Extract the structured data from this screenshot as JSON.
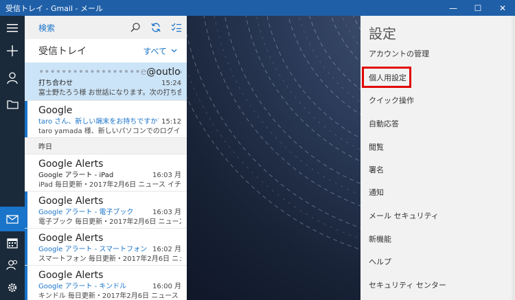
{
  "window": {
    "title": "受信トレイ - Gmail - メール",
    "minimize": "—",
    "maximize": "☐",
    "close": "✕"
  },
  "toolbar": {
    "search_label": "検索"
  },
  "inbox": {
    "title": "受信トレイ",
    "filter": "すべて"
  },
  "messages": [
    {
      "from": "@outlook.jp",
      "from_blurred": "••••••••••••••••••e",
      "subject": "打ち合わせ",
      "time": "15:24",
      "preview": "富士野たろう様 お世話になります。次の打ち合わ"
    },
    {
      "from": "Google",
      "subject": "taro さん、新しい端末をお持ちですか？Window",
      "time": "15:12",
      "preview": "taro yamada 様、新しいパソコンでのログインに成功"
    }
  ],
  "group_yesterday": "昨日",
  "alerts": [
    {
      "from": "Google Alerts",
      "subject": "Google アラート - iPad",
      "time": "16:03 月",
      "preview": "iPad 毎日更新・2017年2月6日 ニュース イチオ"
    },
    {
      "from": "Google Alerts",
      "subject": "Google アラート - 電子ブック",
      "time": "16:03 月",
      "preview": "電子ブック 毎日更新・2017年2月6日 ニュース"
    },
    {
      "from": "Google Alerts",
      "subject": "Google アラート - スマートフォン",
      "time": "16:02 月",
      "preview": "スマートフォン 毎日更新・2017年2月6日 ニュース"
    },
    {
      "from": "Google Alerts",
      "subject": "Google アラート - キンドル",
      "time": "16:00 月",
      "preview": "キンドル 毎日更新・2017年2月6日 ニュース"
    }
  ],
  "settings": {
    "title": "設定",
    "items": [
      "アカウントの管理",
      "個人用設定",
      "クイック操作",
      "自動応答",
      "閲覧",
      "署名",
      "通知",
      "メール セキュリティ",
      "新機能",
      "ヘルプ",
      "セキュリティ センター"
    ]
  },
  "colors": {
    "titlebar": "#1f5fa8",
    "accent": "#1a74c9",
    "rail": "#1b2a3a",
    "highlight": "#e00000",
    "selected": "#cce4f7"
  }
}
